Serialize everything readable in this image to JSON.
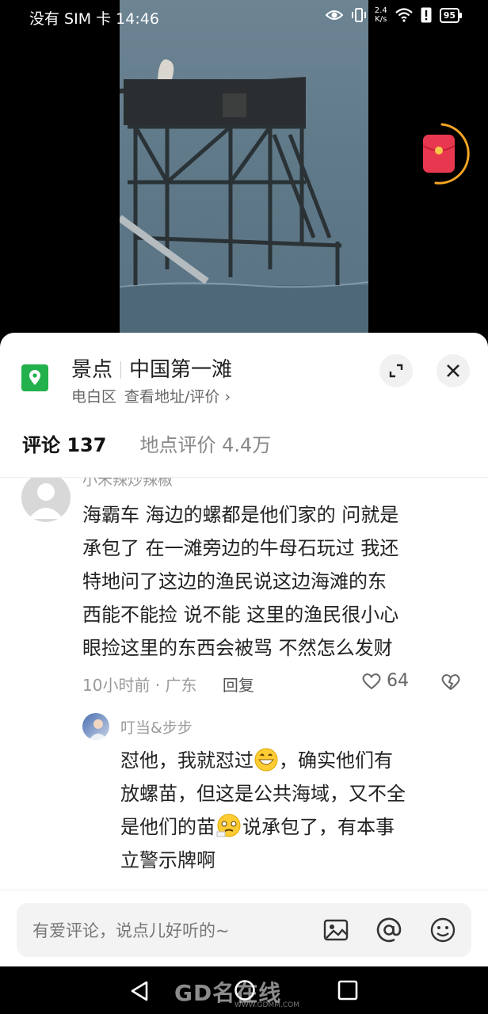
{
  "status_bar": {
    "carrier_time": "没有 SIM 卡 14:46",
    "net_speed_value": "2.4",
    "net_speed_unit": "K/s",
    "battery": "95",
    "icons": [
      "eye-icon",
      "vibrate-icon",
      "wifi-icon",
      "alert-icon",
      "battery-icon"
    ]
  },
  "poi": {
    "category": "景点",
    "name": "中国第一滩",
    "district": "电白区",
    "address_link": "查看地址/评价 ›",
    "icons": [
      "location-pin-icon",
      "expand-icon",
      "close-icon"
    ]
  },
  "tabs": {
    "comments_label": "评论",
    "comments_count": "137",
    "reviews_label": "地点评价",
    "reviews_count": "4.4万"
  },
  "comments": [
    {
      "username": "小禾辣炒辣椒",
      "lines": [
        "海霸车 海边的螺都是他们家的 问就是",
        "承包了 在一滩旁边的牛母石玩过 我还",
        "特地问了这边的渔民说这边海滩的东",
        "西能不能捡 说不能 这里的渔民很小心",
        "眼捡这里的东西会被骂 不然怎么发财"
      ],
      "time": "10小时前",
      "location": "广东",
      "reply_label": "回复",
      "likes": "64"
    },
    {
      "username": "叮当&步步",
      "line1_a": "怼他，我就怼过",
      "line1_b": "，确实他们有",
      "line2": "放螺苗，但这是公共海域，又不全",
      "line3_a": "是他们的苗",
      "line3_b": "说承包了，有本事",
      "line4": "立警示牌啊"
    }
  ],
  "input": {
    "placeholder": "有爱评论，说点儿好听的~",
    "icons": [
      "image-icon",
      "mention-icon",
      "emoji-icon"
    ]
  },
  "nav": {
    "icons": [
      "back-icon",
      "home-icon",
      "recents-icon"
    ],
    "watermark": "GD名在线",
    "watermark_url": "WWW.GDMM.COM"
  },
  "colors": {
    "accent_green": "#22b14c",
    "red_packet": "#e8384f",
    "ring": "#f5a623"
  }
}
